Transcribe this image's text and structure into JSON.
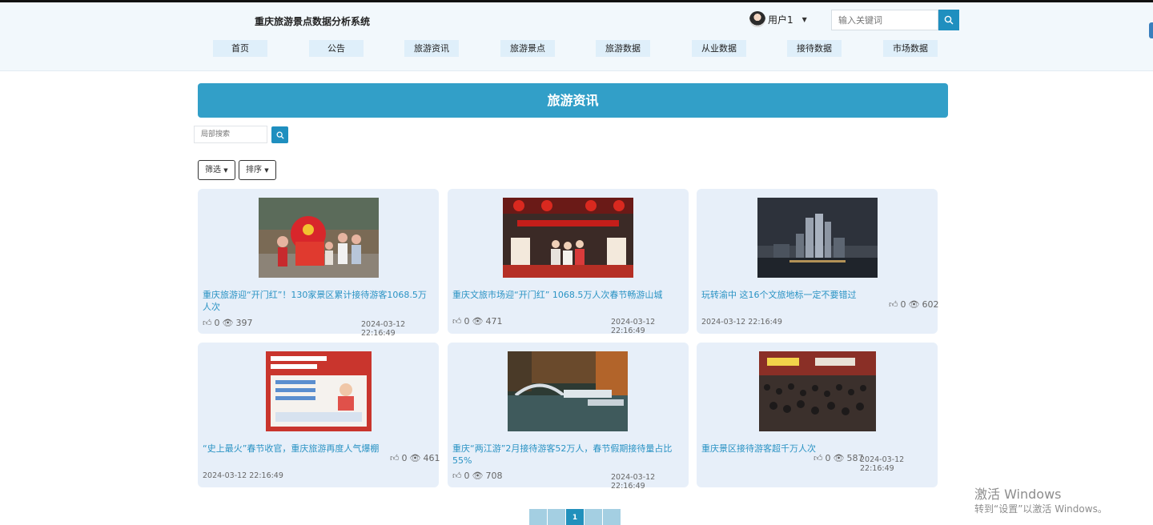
{
  "header": {
    "site_title": "重庆旅游景点数据分析系统",
    "user_name": "用户1",
    "search_placeholder": "输入关键词"
  },
  "nav": [
    "首页",
    "公告",
    "旅游资讯",
    "旅游景点",
    "旅游数据",
    "从业数据",
    "接待数据",
    "市场数据"
  ],
  "page": {
    "banner_title": "旅游资讯",
    "local_search_placeholder": "局部搜索",
    "filter_label": "筛选",
    "sort_label": "排序"
  },
  "cards": [
    {
      "title": "重庆旅游迎“开门红”！130家景区累计接待游客1068.5万人次",
      "likes": "0",
      "views": "397",
      "date": "2024-03-12 22:16:49",
      "image": "lion-dance-photo"
    },
    {
      "title": "重庆文旅市场迎“开门红” 1068.5万人次春节畅游山城",
      "likes": "0",
      "views": "471",
      "date": "2024-03-12 22:16:49",
      "image": "stage-performance-photo"
    },
    {
      "title": "玩转渝中 这16个文旅地标一定不要错过",
      "likes": "0",
      "views": "602",
      "date": "2024-03-12 22:16:49",
      "image": "night-skyline-photo"
    },
    {
      "title": "“史上最火”春节收官，重庆旅游再度人气爆棚",
      "likes": "0",
      "views": "461",
      "date": "2024-03-12 22:16:49",
      "image": "travel-poster-photo"
    },
    {
      "title": "重庆“两江游”2月接待游客52万人，春节假期接待量占比55%",
      "likes": "0",
      "views": "708",
      "date": "2024-03-12 22:16:49",
      "image": "river-bridge-photo"
    },
    {
      "title": "重庆景区接待游客超千万人次",
      "likes": "0",
      "views": "587",
      "date": "2024-03-12 22:16:49",
      "image": "crowd-street-photo"
    }
  ],
  "pagination": {
    "current": "1"
  },
  "watermark": {
    "line1": "激活 Windows",
    "line2": "转到“设置”以激活 Windows。"
  },
  "colors": {
    "accent": "#329fc8",
    "button": "#1f8fbf",
    "card_bg": "#e7eff9",
    "link": "#2a93c4"
  }
}
